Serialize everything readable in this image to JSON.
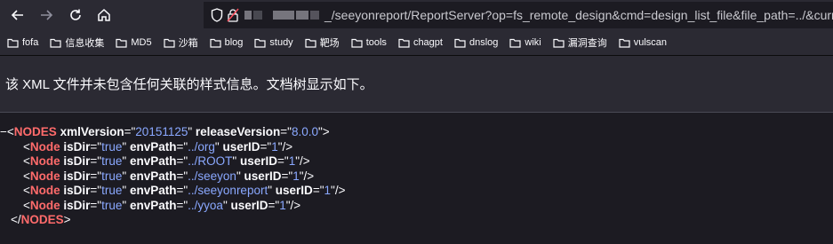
{
  "toolbar": {
    "back_icon": "arrow-left-icon",
    "forward_icon": "arrow-right-icon",
    "reload_icon": "reload-icon",
    "home_icon": "home-icon",
    "url_visible": "_/seeyonreport/ReportServer?op=fs_remote_design&cmd=design_list_file&file_path=../&curre"
  },
  "bookmarks": [
    {
      "label": "fofa"
    },
    {
      "label": "信息收集"
    },
    {
      "label": "MD5"
    },
    {
      "label": "沙箱"
    },
    {
      "label": "blog"
    },
    {
      "label": "study"
    },
    {
      "label": "靶场"
    },
    {
      "label": "tools"
    },
    {
      "label": "chagpt"
    },
    {
      "label": "dnslog"
    },
    {
      "label": "wiki"
    },
    {
      "label": "漏洞查询"
    },
    {
      "label": "vulscan"
    }
  ],
  "info_message": "该 XML 文件并未包含任何关联的样式信息。文档树显示如下。",
  "xml": {
    "collapse_toggle": "−",
    "root_tag": "NODES",
    "root_attrs": [
      {
        "name": "xmlVersion",
        "value": "20151125"
      },
      {
        "name": "releaseVersion",
        "value": "8.0.0"
      }
    ],
    "child_tag": "Node",
    "nodes": [
      {
        "isDir": "true",
        "envPath": "../org",
        "userID": "1"
      },
      {
        "isDir": "true",
        "envPath": "../ROOT",
        "userID": "1"
      },
      {
        "isDir": "true",
        "envPath": "../seeyon",
        "userID": "1"
      },
      {
        "isDir": "true",
        "envPath": "../seeyonreport",
        "userID": "1"
      },
      {
        "isDir": "true",
        "envPath": "../yyoa",
        "userID": "1"
      }
    ]
  }
}
